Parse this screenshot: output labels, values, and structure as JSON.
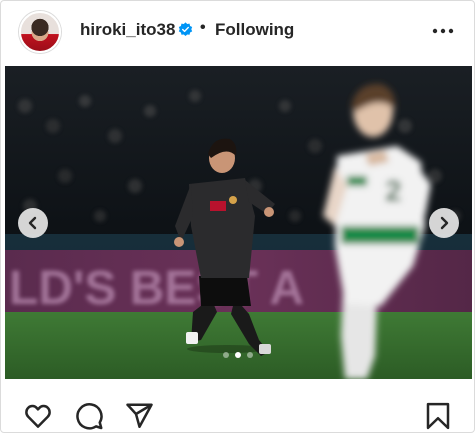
{
  "post": {
    "username": "hiroki_ito38",
    "separator": "•",
    "follow_status": "Following"
  },
  "icons": {
    "avatar": "profile-avatar",
    "verified": "verified-badge-icon",
    "more": "more-options-icon",
    "prev": "chevron-left-icon",
    "next": "chevron-right-icon",
    "like": "heart-icon",
    "comment": "comment-icon",
    "share": "paper-plane-icon",
    "save": "bookmark-icon"
  },
  "carousel": {
    "slide_count": 3,
    "active_index": 1
  },
  "colors": {
    "verified_blue": "#0095f6",
    "text": "#262626",
    "border": "#dbdbdb"
  }
}
